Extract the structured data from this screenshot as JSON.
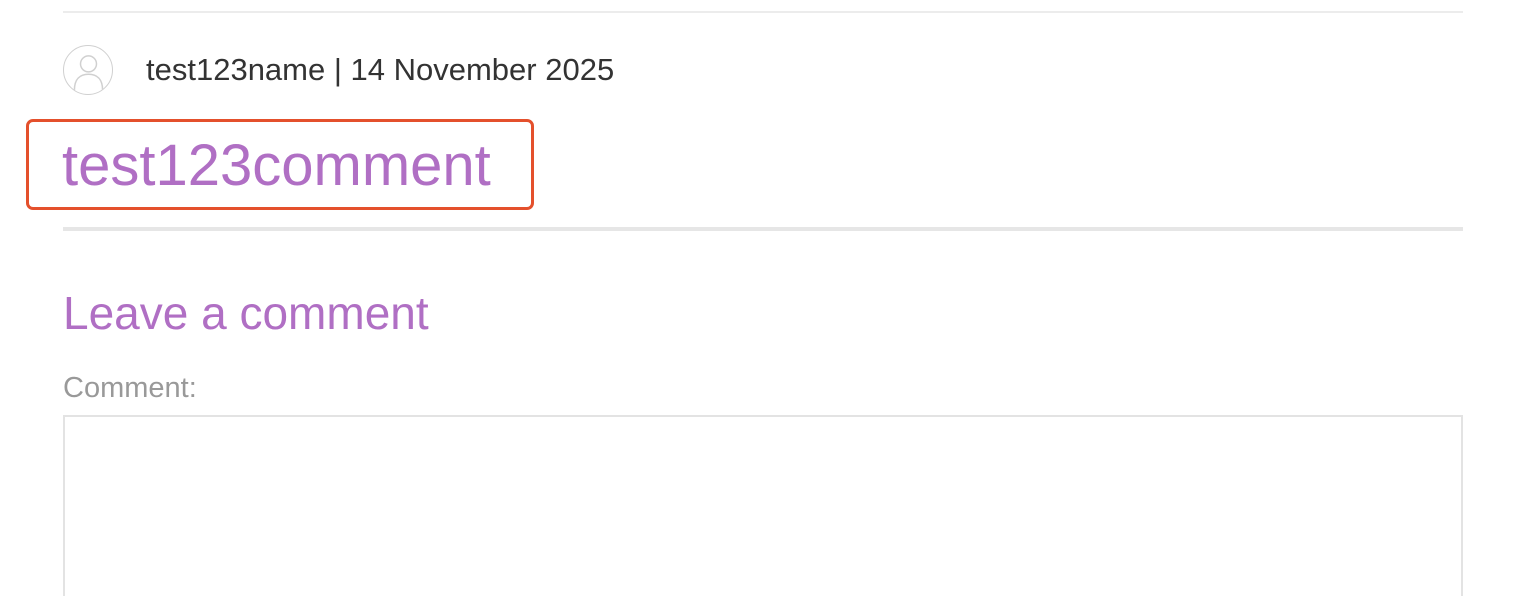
{
  "comment": {
    "author": "test123name",
    "separator": " | ",
    "date": "14 November 2025",
    "meta_text": "test123name | 14 November 2025",
    "avatar_icon": "user-avatar-icon",
    "body": "test123comment",
    "highlight_color": "#e4502c"
  },
  "form": {
    "heading": "Leave a comment",
    "comment_label": "Comment:",
    "comment_value": "",
    "accent_color": "#b06fc4"
  }
}
